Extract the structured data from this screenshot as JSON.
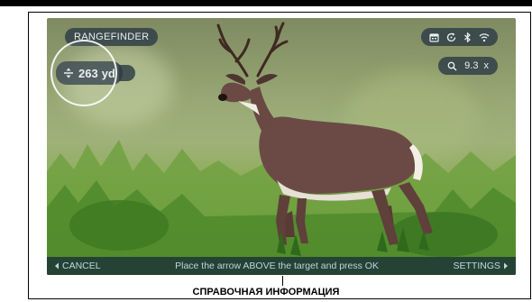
{
  "screen": {
    "mode_label": "RANGEFINDER",
    "range": {
      "value": "263",
      "unit": "yd",
      "icon": "distance-arrow-icon"
    },
    "zoom": {
      "value": "9.3",
      "unit": "x",
      "icon": "magnifier-icon"
    },
    "status_icons": [
      "calendar-icon",
      "sync-icon",
      "bluetooth-icon",
      "wifi-icon"
    ],
    "bottom_bar": {
      "cancel": "CANCEL",
      "instruction": "Place the arrow ABOVE the target and press OK",
      "settings": "SETTINGS"
    }
  },
  "caption": "СПРАВОЧНАЯ ИНФОРМАЦИЯ",
  "colors": {
    "overlay": "#2d3c46",
    "bar_text": "#bcd9e6",
    "frame": "#000000"
  }
}
